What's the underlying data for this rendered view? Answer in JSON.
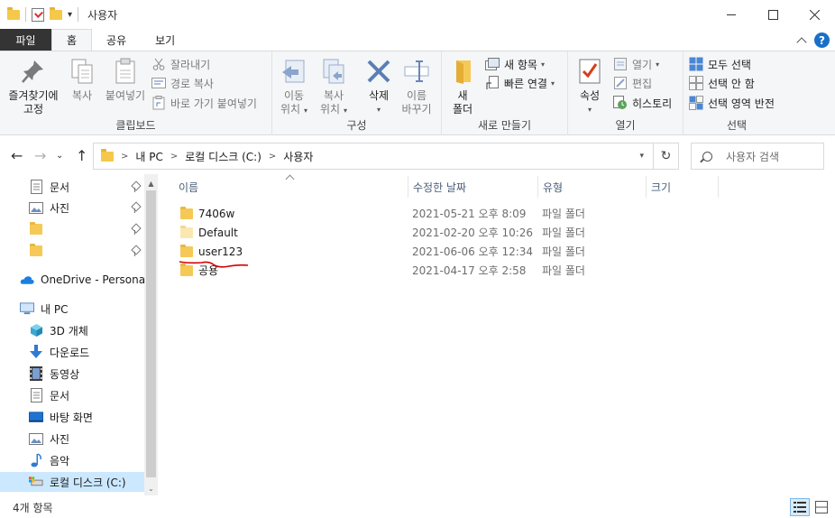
{
  "window": {
    "title": "사용자"
  },
  "ribbon_tabs": [
    {
      "label": "파일"
    },
    {
      "label": "홈"
    },
    {
      "label": "공유"
    },
    {
      "label": "보기"
    }
  ],
  "ribbon": {
    "clipboard": {
      "group_label": "클립보드",
      "pin_line1": "즐겨찾기에",
      "pin_line2": "고정",
      "copy": "복사",
      "paste": "붙여넣기",
      "cut": "잘라내기",
      "copy_path": "경로 복사",
      "paste_shortcut": "바로 가기 붙여넣기"
    },
    "organize": {
      "group_label": "구성",
      "move_line1": "이동",
      "move_line2": "위치",
      "copyto_line1": "복사",
      "copyto_line2": "위치",
      "delete": "삭제",
      "rename_line1": "이름",
      "rename_line2": "바꾸기"
    },
    "new": {
      "group_label": "새로 만들기",
      "new_folder_line1": "새",
      "new_folder_line2": "폴더",
      "new_item": "새 항목",
      "easy_access": "빠른 연결"
    },
    "open": {
      "group_label": "열기",
      "properties": "속성",
      "open": "열기",
      "edit": "편집",
      "history": "히스토리"
    },
    "select": {
      "group_label": "선택",
      "select_all": "모두 선택",
      "select_none": "선택 안 함",
      "invert": "선택 영역 반전"
    }
  },
  "address": {
    "crumbs": [
      "내 PC",
      "로컬 디스크 (C:)",
      "사용자"
    ],
    "search_placeholder": "사용자 검색"
  },
  "nav_pane": {
    "quick_access": [
      {
        "label": "문서",
        "icon": "document-icon"
      },
      {
        "label": "사진",
        "icon": "pictures-icon"
      },
      {
        "label": "",
        "icon": "folder-icon"
      },
      {
        "label": "",
        "icon": "folder-icon"
      }
    ],
    "onedrive": "OneDrive - Personal",
    "this_pc": "내 PC",
    "pc_items": [
      {
        "label": "3D 개체",
        "icon": "3d-objects-icon"
      },
      {
        "label": "다운로드",
        "icon": "download-icon"
      },
      {
        "label": "동영상",
        "icon": "video-icon"
      },
      {
        "label": "문서",
        "icon": "document-icon"
      },
      {
        "label": "바탕 화면",
        "icon": "desktop-icon"
      },
      {
        "label": "사진",
        "icon": "pictures-icon"
      },
      {
        "label": "음악",
        "icon": "music-icon"
      },
      {
        "label": "로컬 디스크 (C:)",
        "icon": "drive-icon"
      }
    ]
  },
  "file_list": {
    "columns": [
      "이름",
      "수정한 날짜",
      "유형",
      "크기"
    ],
    "rows": [
      {
        "name": "7406w",
        "date": "2021-05-21 오후 8:09",
        "type": "파일 폴더"
      },
      {
        "name": "Default",
        "date": "2021-02-20 오후 10:26",
        "type": "파일 폴더"
      },
      {
        "name": "user123",
        "date": "2021-06-06 오후 12:34",
        "type": "파일 폴더"
      },
      {
        "name": "공용",
        "date": "2021-04-17 오후 2:58",
        "type": "파일 폴더"
      }
    ]
  },
  "status": {
    "item_count": "4개 항목"
  },
  "colors": {
    "accent": "#1a6fc7",
    "selection": "#cce8ff",
    "folder": "#f6c957",
    "annotation": "#d40000"
  }
}
